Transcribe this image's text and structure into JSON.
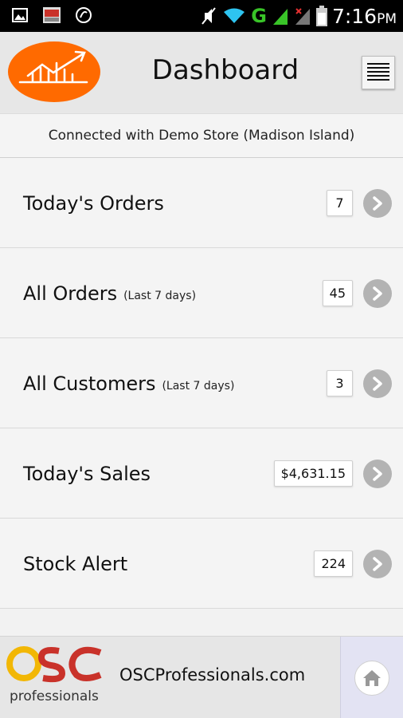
{
  "status_bar": {
    "network": "G",
    "time": "7:16",
    "time_suffix": "PM",
    "left_icons": [
      "gallery-icon",
      "osc-app-icon",
      "phone-sync-icon"
    ],
    "right_icons": [
      "mute-icon",
      "wifi-icon",
      "signal-icon",
      "signal-x-icon",
      "battery-icon"
    ]
  },
  "header": {
    "title": "Dashboard",
    "logo_icon": "chart-logo-icon",
    "menu_icon": "menu-icon",
    "logo_color": "#ff6a00"
  },
  "banner": {
    "text": "Connected with Demo Store (Madison Island)"
  },
  "rows": [
    {
      "label": "Today's Orders",
      "sub": "",
      "value": "7"
    },
    {
      "label": "All Orders",
      "sub": "(Last 7 days)",
      "value": "45"
    },
    {
      "label": "All Customers",
      "sub": "(Last 7 days)",
      "value": "3"
    },
    {
      "label": "Today's Sales",
      "sub": "",
      "value": "$4,631.15"
    },
    {
      "label": "Stock Alert",
      "sub": "",
      "value": "224"
    }
  ],
  "footer": {
    "brand_text": "OSCProfessionals.com",
    "logo_word": "professionals",
    "logo_letters": "OSC",
    "home_icon": "home-icon",
    "brand_color": "#c9322a"
  }
}
